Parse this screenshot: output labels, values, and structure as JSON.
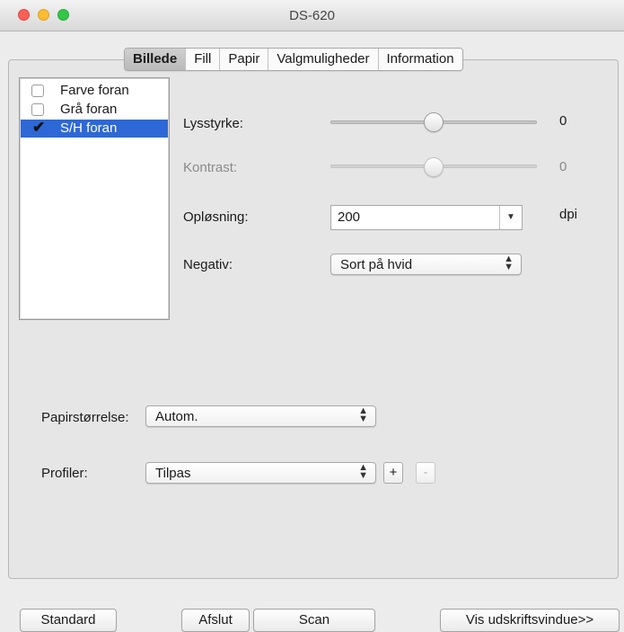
{
  "window": {
    "title": "DS-620"
  },
  "tabs": [
    "Billede",
    "Fill",
    "Papir",
    "Valgmuligheder",
    "Information"
  ],
  "active_tab": "Billede",
  "image_types": [
    {
      "label": "Farve foran",
      "checked": false,
      "selected": false
    },
    {
      "label": "Grå foran",
      "checked": false,
      "selected": false
    },
    {
      "label": "S/H foran",
      "checked": true,
      "selected": true
    }
  ],
  "brightness": {
    "label": "Lysstyrke:",
    "value": "0",
    "position": 0.5
  },
  "contrast": {
    "label": "Kontrast:",
    "value": "0",
    "position": 0.5
  },
  "resolution": {
    "label": "Opløsning:",
    "value": "200",
    "unit": "dpi"
  },
  "negative": {
    "label": "Negativ:",
    "value": "Sort på hvid"
  },
  "paper_size": {
    "label": "Papirstørrelse:",
    "value": "Autom."
  },
  "profiles": {
    "label": "Profiler:",
    "value": "Tilpas",
    "add": "+",
    "remove": "-"
  },
  "buttons": {
    "standard": "Standard",
    "exit": "Afslut",
    "scan": "Scan",
    "preview": "Vis udskriftsvindue>>"
  },
  "icons": {
    "check": "✔",
    "combo_arrow": "▼",
    "popup_arrows": "▲▼"
  }
}
